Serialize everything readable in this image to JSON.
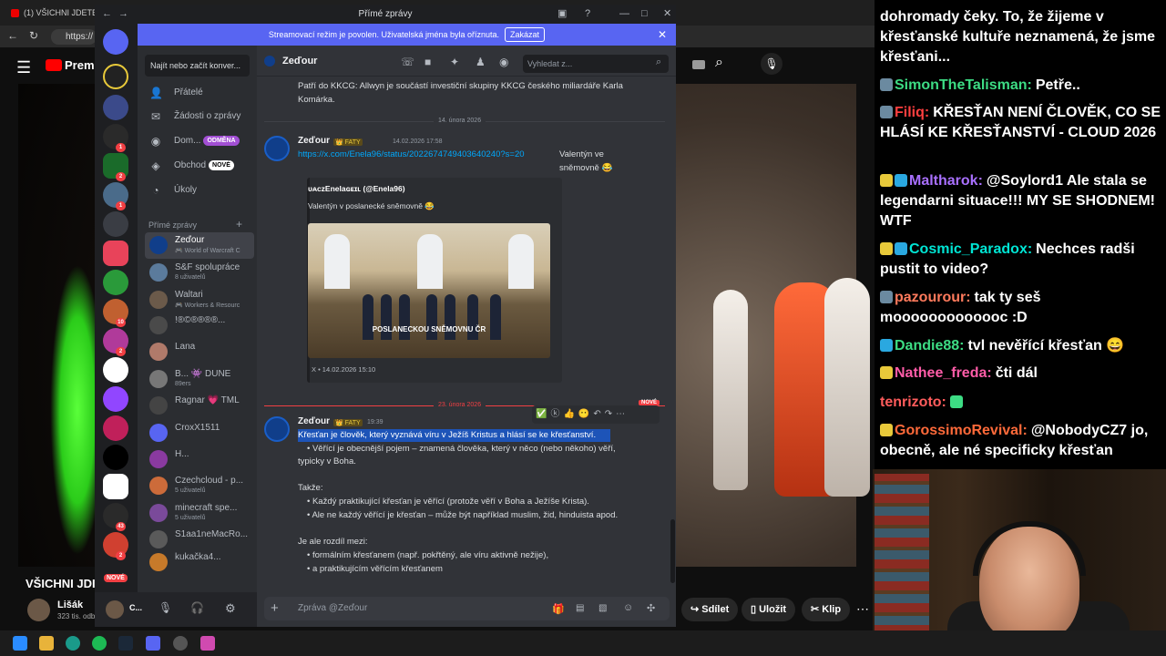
{
  "browser": {
    "tab_title": "(1) VŠICHNI JDETE DO",
    "url": "https://"
  },
  "youtube": {
    "logo": "Premi",
    "video_title": "VŠICHNI JDI",
    "channel": "Lišák",
    "subs": "323 tis. odb",
    "share": "Sdílet",
    "save": "Uložit",
    "clip": "Klip"
  },
  "chat": {
    "messages": [
      {
        "user": "",
        "text": "dohromady čeky. To, že žijeme v křesťanské kultuře neznamená, že jsme křesťani...",
        "color": "#ffffff"
      },
      {
        "user": "SimonTheTalisman:",
        "text": "Petře..",
        "color": "#3ddc84"
      },
      {
        "user": "Filiq:",
        "text": "KŘESŤAN NENÍ ČLOVĚK, CO SE HLÁSÍ KE KŘESŤANSTVÍ - CLOUD 2026",
        "color": "#ff3f3f"
      },
      {
        "user": "Maltharok:",
        "text": "@Soylord1 Ale stala se legendarni situace!!! MY SE SHODNEM! WTF",
        "color": "#a970ff"
      },
      {
        "user": "Cosmic_Paradox:",
        "text": "Nechces radši pustit to video?",
        "color": "#00e5d4"
      },
      {
        "user": "pazourour:",
        "text": "tak ty seš mooooooooooooc :D",
        "color": "#ff7a5c"
      },
      {
        "user": "Dandie88:",
        "text": "tvl nevěřící křesťan 😄",
        "color": "#3ddc84"
      },
      {
        "user": "Nathee_freda:",
        "text": "čti dál",
        "color": "#ff5ca8"
      },
      {
        "user": "tenrizoto:",
        "text": "",
        "color": "#ff5c5c"
      },
      {
        "user": "GorossimoRevival:",
        "text": "@NobodyCZ7 jo, obecně, ale né specificky křesťan",
        "color": "#ff6a3a"
      }
    ]
  },
  "discord": {
    "window_title": "Přímé zprávy",
    "banner": "Streamovací režim je povolen. Uživatelská jména byla oříznuta.",
    "banner_btn": "Zakázat",
    "search": "Najít nebo začít konver...",
    "nav": [
      {
        "label": "Přátelé",
        "icon": "👤"
      },
      {
        "label": "Žádosti o zprávy",
        "icon": "✉"
      },
      {
        "label": "Dom...",
        "icon": "◉",
        "pill": "ODMĚNA",
        "pill_color": "#a24fd4"
      },
      {
        "label": "Obchod",
        "icon": "◈",
        "pill": "NOVÉ",
        "pill_color": "#ffffff"
      },
      {
        "label": "Úkoly",
        "icon": "◔"
      }
    ],
    "dm_header": "Přímé zprávy",
    "dms": [
      {
        "name": "Zeďour",
        "sub": "🎮 World of Warcraft C",
        "color": "#103e8a"
      },
      {
        "name": "S&F spolupráce",
        "sub": "8 uživatelů",
        "color": "#5b7b9c"
      },
      {
        "name": "Waltari",
        "sub": "🎮 Workers & Resourc",
        "color": "#6b5a4a"
      },
      {
        "name": "!®©®®®®...",
        "sub": "",
        "color": "#4a4a4a"
      },
      {
        "name": "Lana",
        "sub": "",
        "color": "#b07a6a"
      },
      {
        "name": "B... 👾 DUNE",
        "sub": "89ers",
        "color": "#777777"
      },
      {
        "name": "Ragnar 💗 TML",
        "sub": "",
        "color": "#444444"
      },
      {
        "name": "CroxX1511",
        "sub": "",
        "color": "#5865f2"
      },
      {
        "name": "H...",
        "sub": "",
        "color": "#8a3aa0"
      },
      {
        "name": "Czechcloud - p...",
        "sub": "5 uživatelů",
        "color": "#cc6b3a"
      },
      {
        "name": "minecraft spe...",
        "sub": "5 uživatelů",
        "color": "#7a4a9a"
      },
      {
        "name": "S1aa1neMacRo...",
        "sub": "",
        "color": "#5a5a5a"
      },
      {
        "name": "kukačka4...",
        "sub": "",
        "color": "#c77a2a"
      }
    ],
    "channel": "Zeďour",
    "channel_search": "Vyhledat z...",
    "msg_top": "Patří do KKCG: Allwyn je součástí investiční skupiny KKCG českého miliardáře Karla Komárka.",
    "date1": "14. února 2026",
    "author": "Zeďour",
    "tag": "👑 FATY",
    "time1": "14.02.2026 17:58",
    "link": "https://x.com/Enela96/status/2022674749403640240?s=20",
    "link_tail": "Valentýn ve sněmovně 😂",
    "embed_author": "ᴜᴀᴄᴢEnelaɢᴇɪʟ (@Enela96)",
    "embed_text": "Valentýn v poslanecké sněmovně 😂",
    "embed_caption": "POSLANECKOU SNĚMOVNU ČR",
    "embed_footer": "X • 14.02.2026 15:10",
    "date2": "23. února 2026",
    "new_badge": "NOVÉ",
    "time2": "19:39",
    "msg_lines": [
      "Křesťan je člověk, který vyznává víru v Ježíš Kristus a hlásí se ke křesťanství.",
      "• Věřící je obecnější pojem – znamená člověka, který v něco (nebo někoho) věří,",
      "typicky v Boha.",
      "Takže:",
      "• Každý praktikující křesťan je věřící (protože věří v Boha a Ježíše Krista).",
      "• Ale ne každý věřící je křesťan – může být například muslim, žid, hinduista apod.",
      "Je ale rozdíl mezi:",
      "• formálním křesťanem (např. pokřtěný, ale víru aktivně nežije),",
      "• a praktikujícím věřícím křesťanem"
    ],
    "composer": "Zpráva @Zeďour",
    "user_initial": "C...",
    "guild_new": "NOVÉ"
  }
}
